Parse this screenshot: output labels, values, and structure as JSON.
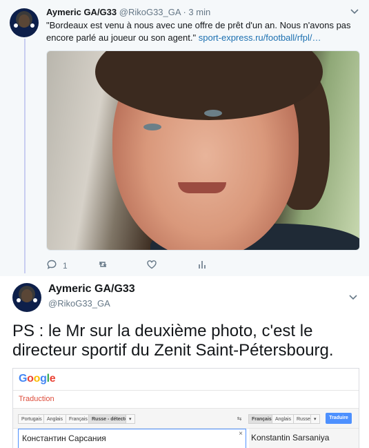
{
  "tweet1": {
    "author_name": "Aymeric GA/G33",
    "handle": "@RikoG33_GA",
    "separator": "·",
    "time": "3 min",
    "text": "\"Bordeaux est venu à nous avec une offre de prêt d'un an. Nous n'avons pas encore parlé au joueur ou son agent.\"",
    "link": "sport-express.ru/football/rfpl/…",
    "reply_count": "1",
    "icons": [
      "reply-icon",
      "retweet-icon",
      "like-icon",
      "analytics-icon",
      "chevron-down-icon"
    ]
  },
  "tweet2": {
    "author_name": "Aymeric GA/G33",
    "handle": "@RikoG33_GA",
    "text": "PS : le Mr sur la deuxième photo, c'est le directeur sportif du Zenit Saint-Pétersbourg."
  },
  "translate": {
    "logo": [
      "G",
      "o",
      "o",
      "g",
      "l",
      "e"
    ],
    "logo_colors": [
      "#4285f4",
      "#ea4335",
      "#fbbc05",
      "#4285f4",
      "#34a853",
      "#ea4335"
    ],
    "title": "Traduction",
    "source_langs": [
      "Portugais",
      "Anglais",
      "Français",
      "Russe - détecté"
    ],
    "target_langs": [
      "Français",
      "Anglais",
      "Russe"
    ],
    "dropdown_glyph": "▾",
    "swap_glyph": "⇆",
    "translate_button": "Traduire",
    "source_text": "Константин Сарсания",
    "clear_glyph": "×",
    "output_text": "Konstantin Sarsaniya"
  },
  "colors": {
    "link": "#1b6fb0",
    "muted": "#657786",
    "thread_line": "#c8cdf0",
    "translate_blue": "#4d90fe",
    "translate_red": "#dd4b39"
  }
}
